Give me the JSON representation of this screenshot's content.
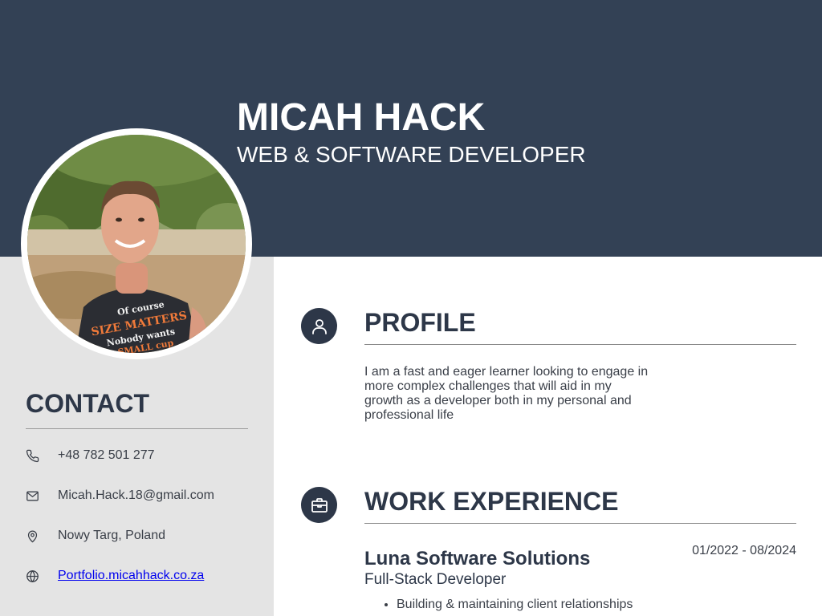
{
  "header": {
    "name": "MICAH HACK",
    "title": "WEB & SOFTWARE DEVELOPER"
  },
  "contact": {
    "heading": "CONTACT",
    "phone": "+48 782 501 277",
    "email": "Micah.Hack.18@gmail.com",
    "location": "Nowy Targ, Poland",
    "website": "Portfolio.micahhack.co.za"
  },
  "profile": {
    "heading": "PROFILE",
    "text": "I am a fast and eager learner looking to engage in more complex challenges that will aid in my growth as a developer both in my personal and professional life"
  },
  "work": {
    "heading": "WORK EXPERIENCE",
    "jobs": [
      {
        "company": "Luna Software Solutions",
        "dates": "01/2022 - 08/2024",
        "role": "Full-Stack Developer",
        "bullets": [
          "Building & maintaining client relationships"
        ]
      }
    ]
  },
  "photo": {
    "shirt_text": [
      "Of course",
      "SIZE MATTERS",
      "Nobody wants",
      "A SMALL cup"
    ]
  },
  "icons": {
    "phone": "phone-icon",
    "email": "mail-icon",
    "location": "map-pin-icon",
    "website": "globe-icon",
    "profile": "user-icon",
    "work": "briefcase-icon"
  },
  "colors": {
    "header_bg": "#334155",
    "sidebar_bg": "#e4e4e4",
    "heading": "#2d3748",
    "body_text": "#3a3f48",
    "link": "#0000ee"
  }
}
